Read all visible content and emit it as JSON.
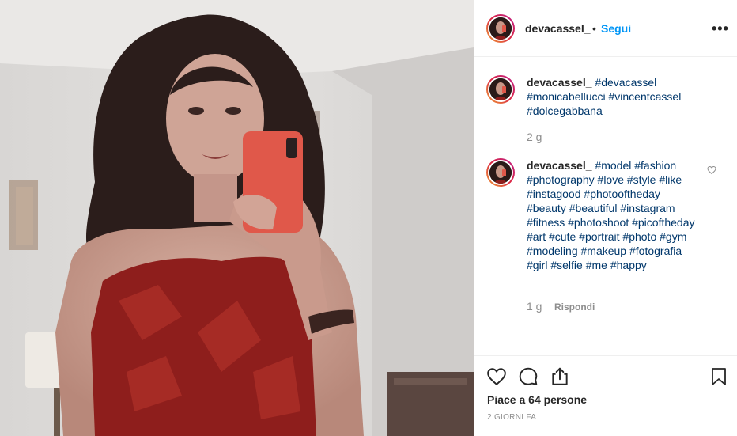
{
  "post": {
    "username": "devacassel_",
    "follow_label": "Segui",
    "dot": "•",
    "more_label": "•••"
  },
  "caption": {
    "username": "devacassel_",
    "tags": [
      "#devacassel",
      "#monicabellucci",
      "#vincentcassel",
      "#dolcegabbana"
    ],
    "time": "2 g"
  },
  "comment": {
    "username": "devacassel_",
    "tags": [
      "#model",
      "#fashion",
      "#photography",
      "#love",
      "#style",
      "#like",
      "#instagood",
      "#photooftheday",
      "#beauty",
      "#beautiful",
      "#instagram",
      "#fitness",
      "#photoshoot",
      "#picoftheday",
      "#art",
      "#cute",
      "#portrait",
      "#photo",
      "#gym",
      "#modeling",
      "#makeup",
      "#fotografia",
      "#girl",
      "#selfie",
      "#me",
      "#happy"
    ],
    "time": "1 g",
    "reply_label": "Rispondi"
  },
  "footer": {
    "likes_text": "Piace a 64 persone",
    "date_text": "2 GIORNI FA"
  },
  "colors": {
    "link": "#0095f6",
    "hashtag": "#00376b",
    "muted": "#8e8e8e",
    "text": "#262626"
  },
  "icons": [
    "more-icon",
    "heart-icon",
    "comment-icon",
    "share-icon",
    "bookmark-icon",
    "small-heart-icon"
  ]
}
